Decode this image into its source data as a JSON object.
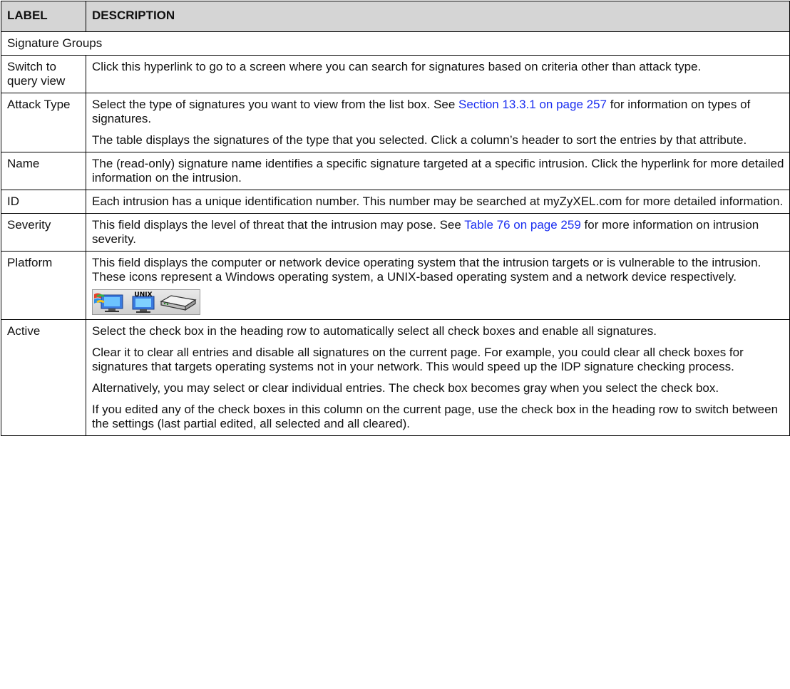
{
  "header": {
    "label": "LABEL",
    "description": "DESCRIPTION"
  },
  "section_title": "Signature Groups",
  "rows": {
    "switch": {
      "label": "Switch to query view",
      "p1": "Click this hyperlink to go to a screen where you can search for signatures based on criteria other than attack type."
    },
    "attack": {
      "label": "Attack Type",
      "p1_pre": "Select the type of signatures you want to view from the list box. See ",
      "p1_link": "Section 13.3.1 on page 257",
      "p1_post": " for information on types of signatures.",
      "p2": "The table displays the signatures of the type that you selected. Click a column’s header to sort the entries by that attribute."
    },
    "name": {
      "label": "Name",
      "p1": "The (read-only) signature name identifies a specific signature targeted at a specific intrusion. Click the hyperlink for more detailed information on the intrusion."
    },
    "id": {
      "label": "ID",
      "p1": "Each intrusion has a unique identification number. This number may be searched at myZyXEL.com for more detailed information."
    },
    "severity": {
      "label": "Severity",
      "p1_pre": "This field displays the level of threat that the intrusion may pose. See ",
      "p1_link": "Table 76 on page 259",
      "p1_post": " for more information on intrusion severity."
    },
    "platform": {
      "label": "Platform",
      "p1": "This field displays the computer or network device operating system that the intrusion targets or is vulnerable to the intrusion. These icons represent a Windows operating system, a UNIX-based operating system and a network device respectively.",
      "icons": [
        "windows-icon",
        "unix-icon",
        "network-device-icon"
      ],
      "unix_text": "UNIX"
    },
    "active": {
      "label": "Active",
      "p1": "Select the check box in the heading row to automatically select all check boxes and enable all signatures.",
      "p2": "Clear it to clear all entries and disable all signatures on the current page. For example, you could clear all check boxes for signatures that targets operating systems not in your network. This would speed up the IDP signature checking process.",
      "p3": "Alternatively, you may select or clear individual entries. The check box becomes gray when you select the check box.",
      "p4": "If you edited any of the check boxes in this column on the current page, use the check box in the heading row to switch between the settings (last partial edited, all selected and all cleared)."
    }
  },
  "colors": {
    "header_bg": "#d5d5d5",
    "link": "#1a2ef0"
  }
}
